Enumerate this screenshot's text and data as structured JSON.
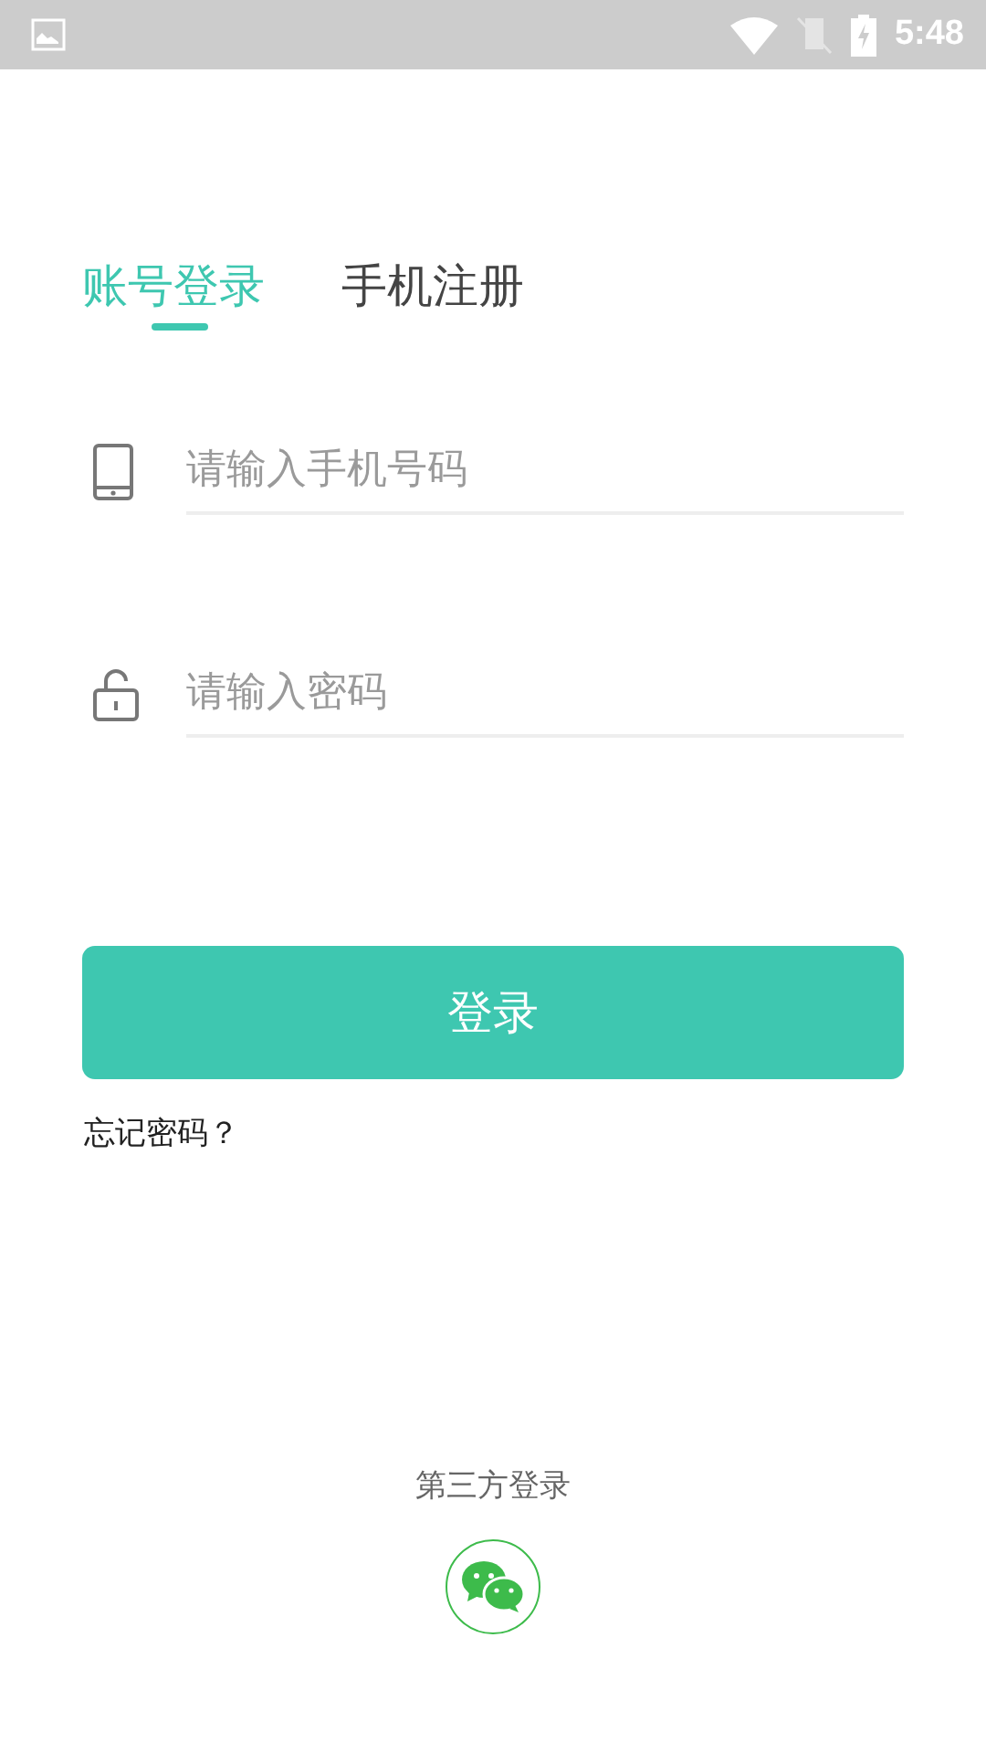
{
  "status_bar": {
    "time": "5:48"
  },
  "tabs": [
    {
      "label": "账号登录",
      "selected": true
    },
    {
      "label": "手机注册",
      "selected": false
    }
  ],
  "fields": [
    {
      "kind": "phone",
      "placeholder": "请输入手机号码"
    },
    {
      "kind": "password",
      "placeholder": "请输入密码"
    }
  ],
  "login_button": "登录",
  "forgot_link": "忘记密码？",
  "third_party": {
    "label": "第三方登录"
  }
}
